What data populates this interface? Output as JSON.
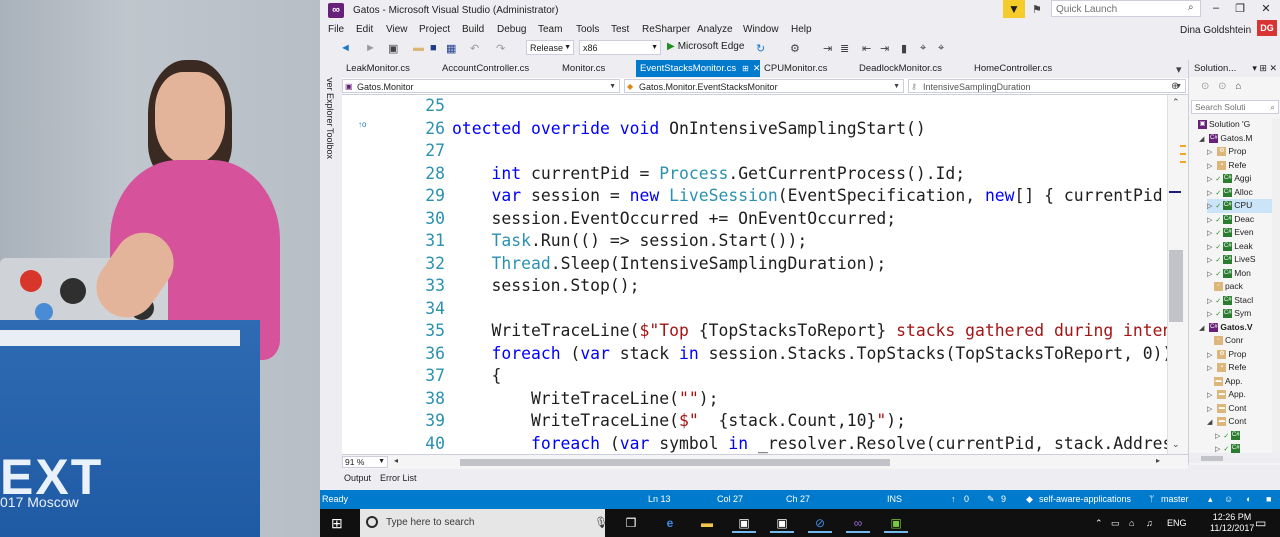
{
  "photo": {
    "event_text": "EXT",
    "event_subtext": "017 Moscow"
  },
  "window": {
    "title": "Gatos - Microsoft Visual Studio (Administrator)",
    "quick_launch_placeholder": "Quick Launch",
    "user_name": "Dina Goldshtein",
    "user_initials": "DG"
  },
  "menu": [
    "File",
    "Edit",
    "View",
    "Project",
    "Build",
    "Debug",
    "Team",
    "Tools",
    "Test",
    "ReSharper",
    "Analyze",
    "Window",
    "Help"
  ],
  "toolbar": {
    "config": "Release",
    "platform": "x86",
    "run_target": "Microsoft Edge"
  },
  "tabs": [
    {
      "label": "LeakMonitor.cs",
      "active": false
    },
    {
      "label": "AccountController.cs",
      "active": false
    },
    {
      "label": "Monitor.cs",
      "active": false
    },
    {
      "label": "EventStacksMonitor.cs",
      "active": true
    },
    {
      "label": "CPUMonitor.cs",
      "active": false
    },
    {
      "label": "DeadlockMonitor.cs",
      "active": false
    },
    {
      "label": "HomeController.cs",
      "active": false
    }
  ],
  "side_rail": [
    "Server Explorer",
    "Toolbox"
  ],
  "navbar": {
    "project": "Gatos.Monitor",
    "type": "Gatos.Monitor.EventStacksMonitor",
    "member": "IntensiveSamplingDuration"
  },
  "code_lines": [
    {
      "num": "25",
      "text": ""
    },
    {
      "num": "26",
      "text": "otected override void OnIntensiveSamplingStart()"
    },
    {
      "num": "27",
      "text": ""
    },
    {
      "num": "28",
      "text": "    int currentPid = Process.GetCurrentProcess().Id;"
    },
    {
      "num": "29",
      "text": "    var session = new LiveSession(EventSpecification, new[] { currentPid },"
    },
    {
      "num": "30",
      "text": "    session.EventOccurred += OnEventOccurred;"
    },
    {
      "num": "31",
      "text": "    Task.Run(() => session.Start());"
    },
    {
      "num": "32",
      "text": "    Thread.Sleep(IntensiveSamplingDuration);"
    },
    {
      "num": "33",
      "text": "    session.Stop();"
    },
    {
      "num": "34",
      "text": ""
    },
    {
      "num": "35",
      "text": "    WriteTraceLine($\"Top {TopStacksToReport} stacks gathered during intensi"
    },
    {
      "num": "36",
      "text": "    foreach (var stack in session.Stacks.TopStacks(TopStacksToReport, 0))"
    },
    {
      "num": "37",
      "text": "    {"
    },
    {
      "num": "38",
      "text": "        WriteTraceLine(\"\");"
    },
    {
      "num": "39",
      "text": "        WriteTraceLine($\"  {stack.Count,10}\");"
    },
    {
      "num": "40",
      "text": "        foreach (var symbol in _resolver.Resolve(currentPid, stack.Addresse"
    }
  ],
  "editor": {
    "zoom": "91 %"
  },
  "bottom_tabs": [
    "Output",
    "Error List"
  ],
  "solution_explorer": {
    "title": "Solution...",
    "search_placeholder": "Search Soluti",
    "items": [
      {
        "label": "Solution 'G",
        "indent": 0,
        "icon": "sln",
        "expander": "",
        "selected": false
      },
      {
        "label": "Gatos.M",
        "indent": 1,
        "icon": "proj",
        "expander": "◢",
        "selected": false
      },
      {
        "label": "Prop",
        "indent": 2,
        "icon": "wrench",
        "expander": "▷",
        "selected": false
      },
      {
        "label": "Refe",
        "indent": 2,
        "icon": "ref",
        "expander": "▷",
        "selected": false
      },
      {
        "label": "Aggi",
        "indent": 2,
        "icon": "cs",
        "expander": "▷",
        "selected": false
      },
      {
        "label": "Alloc",
        "indent": 2,
        "icon": "cs",
        "expander": "▷",
        "selected": false
      },
      {
        "label": "CPU",
        "indent": 2,
        "icon": "cs",
        "expander": "▷",
        "selected": true
      },
      {
        "label": "Deac",
        "indent": 2,
        "icon": "cs",
        "expander": "▷",
        "selected": false
      },
      {
        "label": "Even",
        "indent": 2,
        "icon": "cs",
        "expander": "▷",
        "selected": false
      },
      {
        "label": "Leak",
        "indent": 2,
        "icon": "cs",
        "expander": "▷",
        "selected": false
      },
      {
        "label": "LiveS",
        "indent": 2,
        "icon": "cs",
        "expander": "▷",
        "selected": false
      },
      {
        "label": "Mon",
        "indent": 2,
        "icon": "cs",
        "expander": "▷",
        "selected": false
      },
      {
        "label": "pack",
        "indent": 2,
        "icon": "file",
        "expander": "",
        "selected": false
      },
      {
        "label": "Stacl",
        "indent": 2,
        "icon": "cs",
        "expander": "▷",
        "selected": false
      },
      {
        "label": "Sym",
        "indent": 2,
        "icon": "cs",
        "expander": "▷",
        "selected": false
      },
      {
        "label": "Gatos.V",
        "indent": 1,
        "icon": "proj",
        "expander": "◢",
        "selected": false
      },
      {
        "label": "Conr",
        "indent": 2,
        "icon": "file",
        "expander": "",
        "selected": false
      },
      {
        "label": "Prop",
        "indent": 2,
        "icon": "wrench",
        "expander": "▷",
        "selected": false
      },
      {
        "label": "Refe",
        "indent": 2,
        "icon": "ref",
        "expander": "▷",
        "selected": false
      },
      {
        "label": "App.",
        "indent": 2,
        "icon": "folder",
        "expander": "",
        "selected": false
      },
      {
        "label": "App.",
        "indent": 2,
        "icon": "folder",
        "expander": "▷",
        "selected": false
      },
      {
        "label": "Cont",
        "indent": 2,
        "icon": "folder",
        "expander": "▷",
        "selected": false
      },
      {
        "label": "Cont",
        "indent": 2,
        "icon": "folder",
        "expander": "◢",
        "selected": false
      },
      {
        "label": "",
        "indent": 3,
        "icon": "cs",
        "expander": "▷",
        "selected": false
      },
      {
        "label": "",
        "indent": 3,
        "icon": "cs",
        "expander": "▷",
        "selected": false
      }
    ]
  },
  "status": {
    "state": "Ready",
    "line": "Ln 13",
    "col": "Col 27",
    "ch": "Ch 27",
    "mode": "INS",
    "up_count": "0",
    "edit_count": "9",
    "repo": "self-aware-applications",
    "branch": "master"
  },
  "taskbar": {
    "search_placeholder": "Type here to search",
    "lang": "ENG",
    "time": "12:26 PM",
    "date": "11/12/2017"
  },
  "colors": {
    "accent": "#007acc",
    "vs_purple": "#68217a",
    "keyword": "#0000ff",
    "type": "#2b91af",
    "string": "#a31515"
  }
}
